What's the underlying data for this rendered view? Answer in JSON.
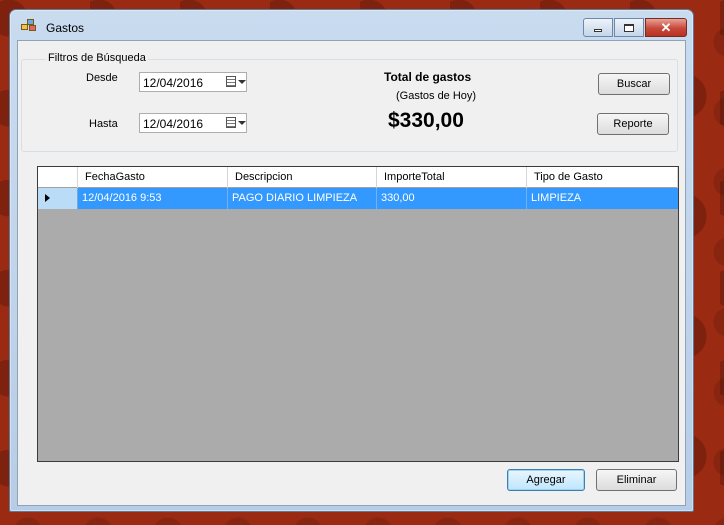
{
  "window": {
    "title": "Gastos"
  },
  "filters": {
    "legend": "Filtros de Búsqueda",
    "desde_label": "Desde",
    "desde_value": "12/04/2016",
    "hasta_label": "Hasta",
    "hasta_value": "12/04/2016"
  },
  "summary": {
    "title": "Total de gastos",
    "subtitle": "(Gastos de Hoy)",
    "amount": "$330,00"
  },
  "buttons": {
    "buscar": "Buscar",
    "reporte": "Reporte",
    "agregar": "Agregar",
    "eliminar": "Eliminar"
  },
  "grid": {
    "columns": [
      "FechaGasto",
      "Descripcion",
      "ImporteTotal",
      "Tipo de Gasto"
    ],
    "rows": [
      [
        "12/04/2016 9:53",
        "PAGO DIARIO LIMPIEZA",
        "330,00",
        "LIMPIEZA"
      ]
    ]
  },
  "icons": {
    "app": "app-icon",
    "calendar": "calendar-icon",
    "dropdown": "chevron-down-icon",
    "row_pointer": "row-pointer-icon"
  },
  "colors": {
    "selection": "#3399ff",
    "grid_background": "#ababab",
    "close_button": "#c7483a"
  }
}
